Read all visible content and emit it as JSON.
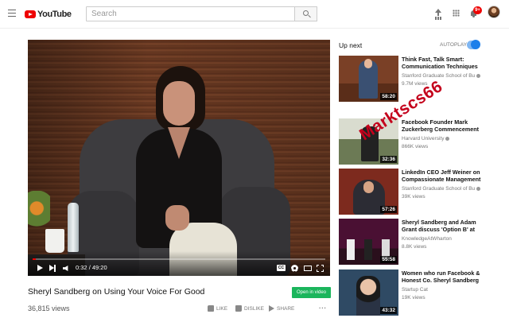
{
  "header": {
    "logo_text": "YouTube",
    "search_placeholder": "Search",
    "notification_count": "9+"
  },
  "player": {
    "current_time": "0:32",
    "duration": "49:20",
    "progress_fraction": 0.011,
    "cc_label": "CC"
  },
  "video": {
    "title": "Sheryl Sandberg on Using Your Voice For Good",
    "views": "36,815 views",
    "open_button_label": "Open in video",
    "actions": {
      "like": "LIKE",
      "dislike": "DISLIKE",
      "share": "SHARE",
      "more": "..."
    }
  },
  "sidebar": {
    "up_next": "Up next",
    "autoplay": "AUTOPLAY",
    "autoplay_on": true,
    "recommendations": [
      {
        "title": "Think Fast, Talk Smart: Communication Techniques",
        "channel": "Stanford Graduate School of Bu",
        "views": "9.7M views",
        "duration": "58:20"
      },
      {
        "title": "Facebook Founder Mark Zuckerberg Commencement",
        "channel": "Harvard University",
        "views": "866K views",
        "duration": "32:36"
      },
      {
        "title": "LinkedIn CEO Jeff Weiner on Compassionate Management",
        "channel": "Stanford Graduate School of Bu",
        "views": "39K views",
        "duration": "57:26"
      },
      {
        "title": "Sheryl Sandberg and Adam Grant discuss 'Option B' at",
        "channel": "KnowledgeAtWharton",
        "views": "8.8K views",
        "duration": "55:58"
      },
      {
        "title": "Women who run Facebook & Honest Co. Sheryl Sandberg &",
        "channel": "Startup Cat",
        "views": "19K views",
        "duration": "43:32"
      }
    ]
  },
  "watermark": {
    "text": "Marktscs66",
    "color": "#c4001c"
  },
  "colors": {
    "brand_red": "#e00000",
    "open_button": "#1bb55c",
    "toggle_blue": "#1c7fea"
  }
}
